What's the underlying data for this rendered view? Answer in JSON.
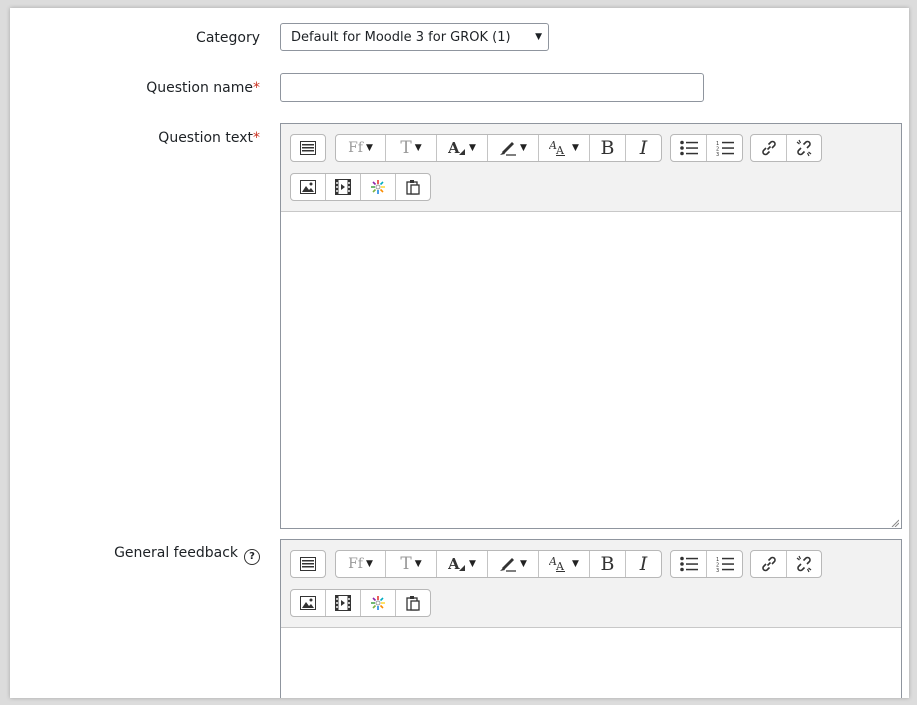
{
  "form": {
    "category_label": "Category",
    "category_value": "Default for Moodle 3 for GROK (1)",
    "question_name_label": "Question name",
    "question_text_label": "Question text",
    "general_feedback_label": "General feedback",
    "required_marker": "*",
    "help_glyph": "?",
    "question_name_value": ""
  },
  "toolbar": {
    "font_family_glyph": "Ff",
    "font_size_glyph": "T",
    "bold_glyph": "B",
    "italic_glyph": "I",
    "icons": [
      "show-more-buttons-icon",
      "font-family-icon",
      "font-size-icon",
      "font-color-icon",
      "background-color-icon",
      "text-style-icon",
      "bold-icon",
      "italic-icon",
      "unordered-list-icon",
      "ordered-list-icon",
      "link-icon",
      "unlink-icon",
      "image-icon",
      "media-icon",
      "h5p-icon",
      "paste-icon"
    ]
  },
  "colors": {
    "required": "#ca3120",
    "toolbar_bg": "#f2f2f2",
    "border": "#8f959e"
  }
}
